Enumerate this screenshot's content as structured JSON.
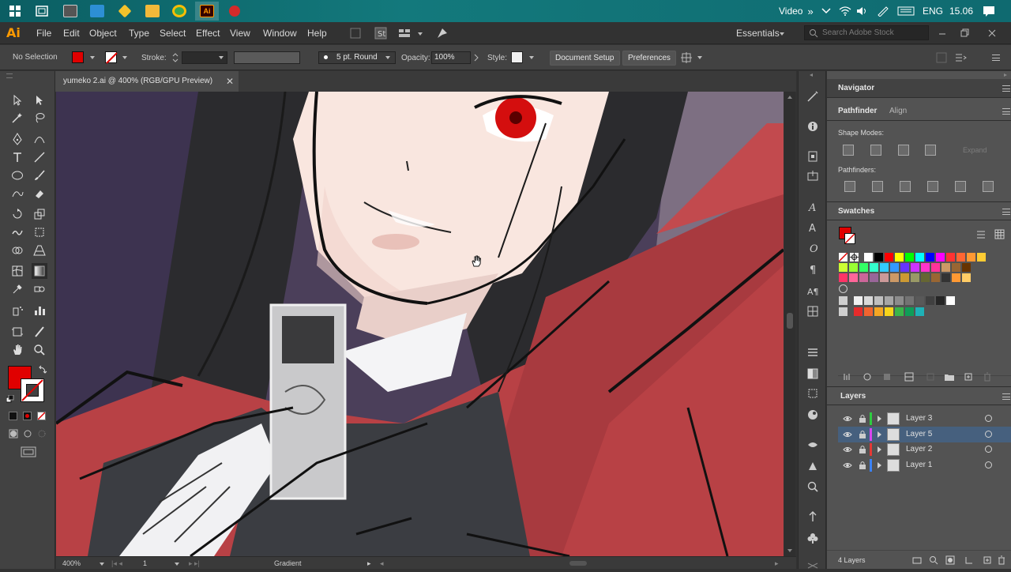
{
  "taskbar": {
    "apps": [
      {
        "name": "windows-start-icon",
        "color": "#ffffff"
      },
      {
        "name": "task-view-icon",
        "color": "#ffffff"
      },
      {
        "name": "app-icon-1",
        "color": "#5a5a5a"
      },
      {
        "name": "app-icon-2",
        "color": "#2d8fd5"
      },
      {
        "name": "app-icon-3",
        "color": "#f3c22b"
      },
      {
        "name": "file-explorer-icon",
        "color": "#f1b93a"
      },
      {
        "name": "chrome-icon",
        "color": "#34a853"
      },
      {
        "name": "illustrator-taskbar-icon",
        "color": "#ff9a00"
      },
      {
        "name": "record-icon",
        "color": "#d42a2a"
      }
    ],
    "video_label": "Video",
    "chevrons": "»",
    "language": "ENG",
    "time": "15.06"
  },
  "app": {
    "logo": "Ai",
    "menus": [
      "File",
      "Edit",
      "Object",
      "Type",
      "Select",
      "Effect",
      "View",
      "Window",
      "Help"
    ],
    "workspace": "Essentials",
    "search_placeholder": "Search Adobe Stock"
  },
  "control": {
    "selection": "No Selection",
    "fill_color": "#e00000",
    "stroke_label": "Stroke:",
    "brush": "5 pt. Round",
    "opacity_label": "Opacity:",
    "opacity_value": "100%",
    "style_label": "Style:",
    "document_setup": "Document Setup",
    "preferences": "Preferences"
  },
  "document": {
    "tab_title": "yumeko 2.ai @ 400% (RGB/GPU Preview)"
  },
  "status": {
    "zoom": "400%",
    "artboard": "1",
    "tool_name": "Gradient"
  },
  "panels": {
    "navigator": "Navigator",
    "pathfinder_tab": "Pathfinder",
    "align_tab": "Align",
    "shape_modes": "Shape Modes:",
    "expand": "Expand",
    "pathfinders": "Pathfinders:",
    "swatches": "Swatches",
    "layers_title": "Layers",
    "layers_count": "4 Layers"
  },
  "swatches": {
    "row1": [
      "#ffffff",
      "#000000",
      "#ff0000",
      "#ffff00",
      "#00ff00",
      "#00ffff",
      "#0000ff",
      "#ff00ff",
      "#ff3333",
      "#ff6633",
      "#ff9933",
      "#ffcc33"
    ],
    "row2": [
      "#ccff33",
      "#99ff33",
      "#33ff66",
      "#33ffcc",
      "#33ccff",
      "#3399ff",
      "#6633ff",
      "#cc33ff",
      "#ff33cc",
      "#ff3399",
      "#cc9966",
      "#996633",
      "#663300"
    ],
    "row3": [
      "#ff3366",
      "#ff6699",
      "#cc6699",
      "#996699",
      "#cc9999",
      "#cc9966",
      "#cc9933",
      "#999966",
      "#666633",
      "#996633",
      "#333333",
      "#ff9933",
      "#ffcc66"
    ],
    "grays": [
      "#f0f0f0",
      "#d9d9d9",
      "#bfbfbf",
      "#a6a6a6",
      "#8c8c8c",
      "#737373",
      "#595959",
      "#404040",
      "#262626",
      "#ffffff"
    ],
    "extra": [
      "#e52b2b",
      "#f0642f",
      "#f5a623",
      "#f8d41a",
      "#3bb54a",
      "#0f9d58",
      "#1fb1b6"
    ]
  },
  "layers": [
    {
      "name": "Layer 3",
      "color": "#2ecc40",
      "selected": false
    },
    {
      "name": "Layer 5",
      "color": "#d946ef",
      "selected": true
    },
    {
      "name": "Layer 2",
      "color": "#e53935",
      "selected": false
    },
    {
      "name": "Layer 1",
      "color": "#3b82f6",
      "selected": false
    }
  ]
}
